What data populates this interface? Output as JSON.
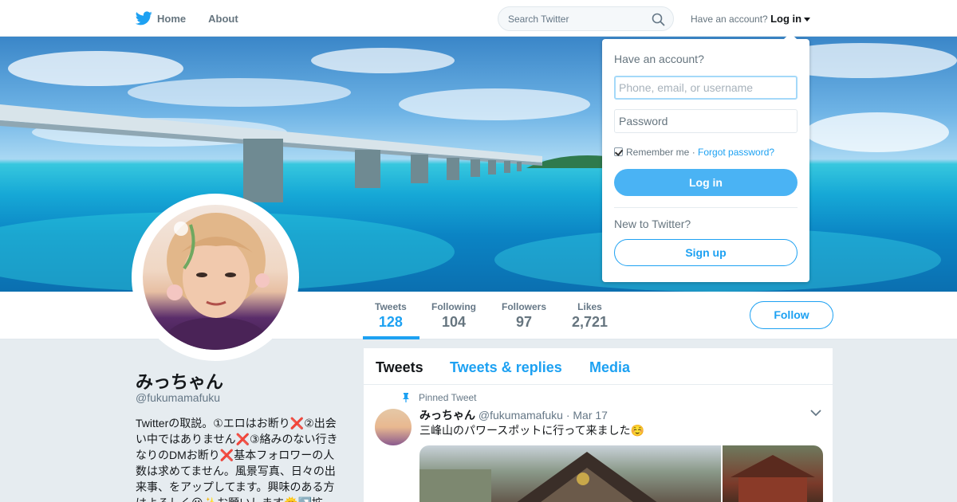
{
  "nav": {
    "home_label": "Home",
    "about_label": "About",
    "search_placeholder": "Search Twitter",
    "account_prompt": "Have an account?",
    "login_label": "Log in"
  },
  "colors": {
    "accent": "#1da1f2",
    "login_button": "#4ab3f4"
  },
  "stats": [
    {
      "label": "Tweets",
      "value": "128"
    },
    {
      "label": "Following",
      "value": "104"
    },
    {
      "label": "Followers",
      "value": "97"
    },
    {
      "label": "Likes",
      "value": "2,721"
    }
  ],
  "follow_label": "Follow",
  "profile": {
    "name": "みっちゃん",
    "handle": "@fukumamafuku",
    "bio": "Twitterの取説。①エロはお断り❌②出会い中ではありません❌③絡みのない行きなりのDMお断り❌基本フォロワーの人数は求めてません。風景写真、日々の出来事、をアップしてます。興味のある方はよろしく😃✨お願いします🌞↗️拡"
  },
  "timeline": {
    "tabs": [
      "Tweets",
      "Tweets & replies",
      "Media"
    ],
    "pinned_label": "Pinned Tweet",
    "tweet": {
      "name": "みっちゃん",
      "handle": "@fukumamafuku",
      "date": "· Mar 17",
      "text": "三峰山のパワースポットに行って来ました☺️"
    }
  },
  "login_dropdown": {
    "title": "Have an account?",
    "username_placeholder": "Phone, email, or username",
    "password_placeholder": "Password",
    "remember_label": "Remember me ·",
    "forgot_label": "Forgot password?",
    "login_button": "Log in",
    "new_prompt": "New to Twitter?",
    "signup_button": "Sign up"
  }
}
